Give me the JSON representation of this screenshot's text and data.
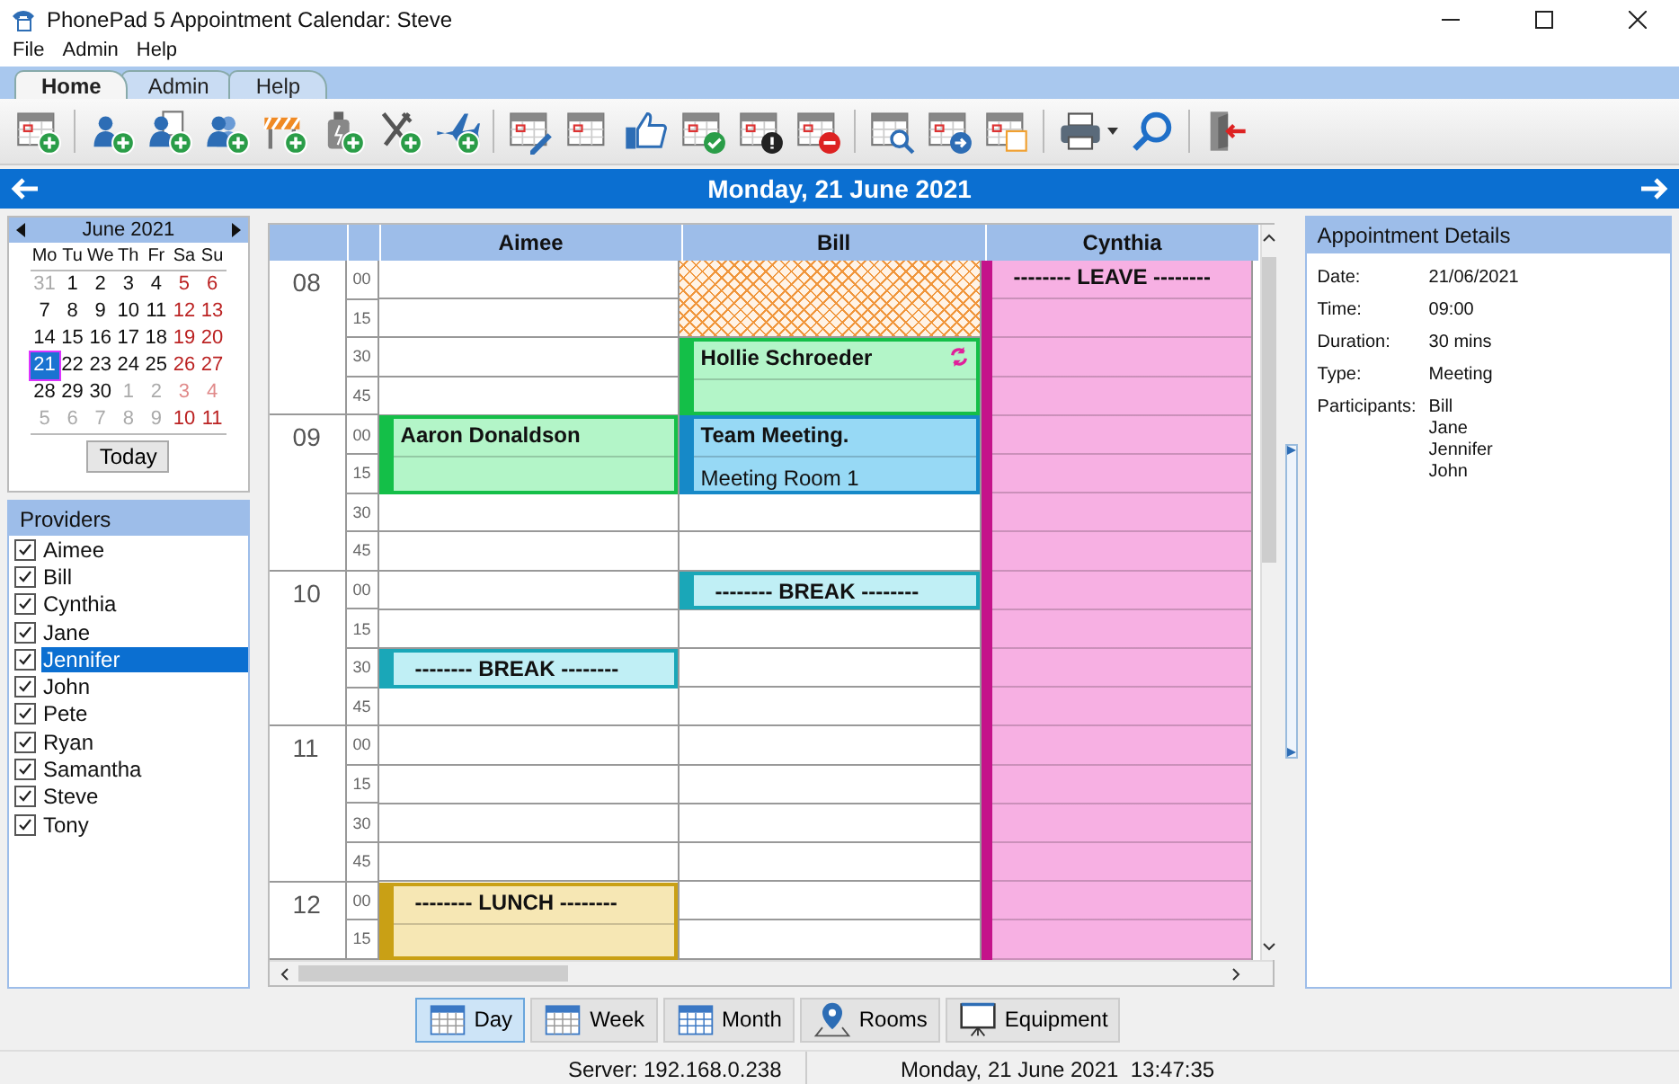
{
  "window": {
    "title": "PhonePad 5 Appointment Calendar: Steve"
  },
  "menu": [
    "File",
    "Admin",
    "Help"
  ],
  "tabs": [
    {
      "label": "Home",
      "selected": true
    },
    {
      "label": "Admin",
      "selected": false
    },
    {
      "label": "Help",
      "selected": false
    }
  ],
  "date_bar": {
    "title": "Monday, 21 June 2021"
  },
  "mini_calendar": {
    "title": "June 2021",
    "weekdays": [
      "Mo",
      "Tu",
      "We",
      "Th",
      "Fr",
      "Sa",
      "Su"
    ],
    "weeks": [
      [
        {
          "day": "31",
          "other_month": true,
          "weekend": false,
          "selected": false
        },
        {
          "day": "1",
          "other_month": false,
          "weekend": false,
          "selected": false
        },
        {
          "day": "2",
          "other_month": false,
          "weekend": false,
          "selected": false
        },
        {
          "day": "3",
          "other_month": false,
          "weekend": false,
          "selected": false
        },
        {
          "day": "4",
          "other_month": false,
          "weekend": false,
          "selected": false
        },
        {
          "day": "5",
          "other_month": false,
          "weekend": true,
          "selected": false
        },
        {
          "day": "6",
          "other_month": false,
          "weekend": true,
          "selected": false
        }
      ],
      [
        {
          "day": "7",
          "other_month": false,
          "weekend": false,
          "selected": false
        },
        {
          "day": "8",
          "other_month": false,
          "weekend": false,
          "selected": false
        },
        {
          "day": "9",
          "other_month": false,
          "weekend": false,
          "selected": false
        },
        {
          "day": "10",
          "other_month": false,
          "weekend": false,
          "selected": false
        },
        {
          "day": "11",
          "other_month": false,
          "weekend": false,
          "selected": false
        },
        {
          "day": "12",
          "other_month": false,
          "weekend": true,
          "selected": false
        },
        {
          "day": "13",
          "other_month": false,
          "weekend": true,
          "selected": false
        }
      ],
      [
        {
          "day": "14",
          "other_month": false,
          "weekend": false,
          "selected": false
        },
        {
          "day": "15",
          "other_month": false,
          "weekend": false,
          "selected": false
        },
        {
          "day": "16",
          "other_month": false,
          "weekend": false,
          "selected": false
        },
        {
          "day": "17",
          "other_month": false,
          "weekend": false,
          "selected": false
        },
        {
          "day": "18",
          "other_month": false,
          "weekend": false,
          "selected": false
        },
        {
          "day": "19",
          "other_month": false,
          "weekend": true,
          "selected": false
        },
        {
          "day": "20",
          "other_month": false,
          "weekend": true,
          "selected": false
        }
      ],
      [
        {
          "day": "21",
          "other_month": false,
          "weekend": false,
          "selected": true
        },
        {
          "day": "22",
          "other_month": false,
          "weekend": false,
          "selected": false
        },
        {
          "day": "23",
          "other_month": false,
          "weekend": false,
          "selected": false
        },
        {
          "day": "24",
          "other_month": false,
          "weekend": false,
          "selected": false
        },
        {
          "day": "25",
          "other_month": false,
          "weekend": false,
          "selected": false
        },
        {
          "day": "26",
          "other_month": false,
          "weekend": true,
          "selected": false
        },
        {
          "day": "27",
          "other_month": false,
          "weekend": true,
          "selected": false
        }
      ],
      [
        {
          "day": "28",
          "other_month": false,
          "weekend": false,
          "selected": false
        },
        {
          "day": "29",
          "other_month": false,
          "weekend": false,
          "selected": false
        },
        {
          "day": "30",
          "other_month": false,
          "weekend": false,
          "selected": false
        },
        {
          "day": "1",
          "other_month": true,
          "weekend": false,
          "selected": false
        },
        {
          "day": "2",
          "other_month": true,
          "weekend": false,
          "selected": false
        },
        {
          "day": "3",
          "other_month": true,
          "weekend": true,
          "selected": false
        },
        {
          "day": "4",
          "other_month": true,
          "weekend": true,
          "selected": false
        }
      ],
      [
        {
          "day": "5",
          "other_month": true,
          "weekend": false,
          "selected": false
        },
        {
          "day": "6",
          "other_month": true,
          "weekend": false,
          "selected": false
        },
        {
          "day": "7",
          "other_month": true,
          "weekend": false,
          "selected": false
        },
        {
          "day": "8",
          "other_month": true,
          "weekend": false,
          "selected": false
        },
        {
          "day": "9",
          "other_month": true,
          "weekend": false,
          "selected": false
        },
        {
          "day": "10",
          "other_month": false,
          "weekend": true,
          "selected": false
        },
        {
          "day": "11",
          "other_month": false,
          "weekend": true,
          "selected": false
        }
      ]
    ],
    "today_button": "Today"
  },
  "providers": {
    "title": "Providers",
    "items": [
      {
        "name": "Aimee",
        "checked": true,
        "selected": false
      },
      {
        "name": "Bill",
        "checked": true,
        "selected": false
      },
      {
        "name": "Cynthia",
        "checked": true,
        "selected": false
      },
      {
        "name": "Jane",
        "checked": true,
        "selected": false
      },
      {
        "name": "Jennifer",
        "checked": true,
        "selected": true
      },
      {
        "name": "John",
        "checked": true,
        "selected": false
      },
      {
        "name": "Pete",
        "checked": true,
        "selected": false
      },
      {
        "name": "Ryan",
        "checked": true,
        "selected": false
      },
      {
        "name": "Samantha",
        "checked": true,
        "selected": false
      },
      {
        "name": "Steve",
        "checked": true,
        "selected": false
      },
      {
        "name": "Tony",
        "checked": true,
        "selected": false
      }
    ]
  },
  "schedule": {
    "hours": [
      {
        "hour": "08",
        "minutes": [
          "00",
          "15",
          "30",
          "45"
        ]
      },
      {
        "hour": "09",
        "minutes": [
          "00",
          "15",
          "30",
          "45"
        ]
      },
      {
        "hour": "10",
        "minutes": [
          "00",
          "15",
          "30",
          "45"
        ]
      },
      {
        "hour": "11",
        "minutes": [
          "00",
          "15",
          "30",
          "45"
        ]
      },
      {
        "hour": "12",
        "minutes": [
          "00",
          "15"
        ]
      }
    ],
    "columns": [
      {
        "name": "Aimee",
        "slots": [
          {
            "kind": "free"
          },
          {
            "kind": "free"
          },
          {
            "kind": "free"
          },
          {
            "kind": "free"
          },
          {
            "kind": "appointment",
            "title": "Aaron Donaldson",
            "recurring": false
          },
          {
            "kind": "appointment"
          },
          {
            "kind": "free"
          },
          {
            "kind": "free"
          },
          {
            "kind": "free"
          },
          {
            "kind": "free"
          },
          {
            "kind": "break",
            "title": "-------- BREAK --------"
          },
          {
            "kind": "free"
          },
          {
            "kind": "free"
          },
          {
            "kind": "free"
          },
          {
            "kind": "free"
          },
          {
            "kind": "free"
          },
          {
            "kind": "lunch",
            "title": "-------- LUNCH --------"
          },
          {
            "kind": "lunch"
          }
        ]
      },
      {
        "name": "Bill",
        "slots": [
          {
            "kind": "unavailable"
          },
          {
            "kind": "unavailable"
          },
          {
            "kind": "appointment",
            "title": "Hollie Schroeder",
            "recurring": true
          },
          {
            "kind": "appointment"
          },
          {
            "kind": "meeting",
            "title": "Team Meeting.",
            "recurring": false
          },
          {
            "kind": "meeting",
            "note": "Meeting Room 1"
          },
          {
            "kind": "free"
          },
          {
            "kind": "free"
          },
          {
            "kind": "break",
            "title": "-------- BREAK --------"
          },
          {
            "kind": "free"
          },
          {
            "kind": "free"
          },
          {
            "kind": "free"
          },
          {
            "kind": "free"
          },
          {
            "kind": "free"
          },
          {
            "kind": "free"
          },
          {
            "kind": "free"
          },
          {
            "kind": "free"
          },
          {
            "kind": "free"
          }
        ]
      },
      {
        "name": "Cynthia",
        "slots": [
          {
            "kind": "leave",
            "title": "-------- LEAVE --------"
          },
          {
            "kind": "leave"
          },
          {
            "kind": "leave"
          },
          {
            "kind": "leave"
          },
          {
            "kind": "leave"
          },
          {
            "kind": "leave"
          },
          {
            "kind": "leave"
          },
          {
            "kind": "leave"
          },
          {
            "kind": "leave"
          },
          {
            "kind": "leave"
          },
          {
            "kind": "leave"
          },
          {
            "kind": "leave"
          },
          {
            "kind": "leave"
          },
          {
            "kind": "leave"
          },
          {
            "kind": "leave"
          },
          {
            "kind": "leave"
          },
          {
            "kind": "leave"
          },
          {
            "kind": "leave"
          }
        ]
      }
    ]
  },
  "details": {
    "title": "Appointment Details",
    "fields": [
      {
        "label": "Date:",
        "values": [
          "21/06/2021"
        ]
      },
      {
        "label": "Time:",
        "values": [
          "09:00"
        ]
      },
      {
        "label": "Duration:",
        "values": [
          "30 mins"
        ]
      },
      {
        "label": "Type:",
        "values": [
          "Meeting"
        ]
      },
      {
        "label": "Participants:",
        "values": [
          "Bill",
          "Jane",
          "Jennifer",
          "John"
        ]
      }
    ]
  },
  "views": [
    {
      "label": "Day",
      "selected": true
    },
    {
      "label": "Week",
      "selected": false
    },
    {
      "label": "Month",
      "selected": false
    },
    {
      "label": "Rooms",
      "selected": false
    },
    {
      "label": "Equipment",
      "selected": false
    }
  ],
  "status_bar": {
    "server": "Server: 192.168.0.238",
    "datetime": "Monday, 21 June 2021  13:47:35"
  }
}
